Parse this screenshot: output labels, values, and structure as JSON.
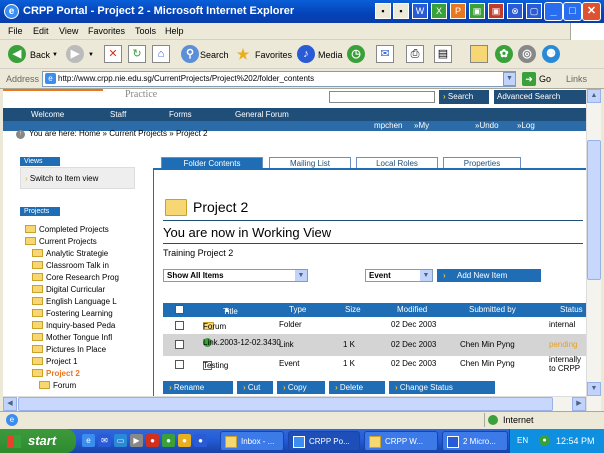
{
  "window": {
    "title": "CRPP Portal - Project 2 - Microsoft Internet Explorer"
  },
  "menu": [
    "File",
    "Edit",
    "View",
    "Favorites",
    "Tools",
    "Help"
  ],
  "toolbar": {
    "back": "Back",
    "search": "Search",
    "favorites": "Favorites",
    "media": "Media"
  },
  "address": {
    "label": "Address",
    "url": "http://www.crpp.nie.edu.sg/CurrentProjects/Project%202/folder_contents",
    "go": "Go",
    "links": "Links"
  },
  "site": {
    "practice": "Practice",
    "search_btn": "Search",
    "adv_search": "Advanced Search",
    "nav": [
      "Welcome",
      "Staff",
      "Forms",
      "General Forum"
    ],
    "user_links": [
      "mpchen",
      "My Profile",
      "Undo",
      "Log out"
    ]
  },
  "breadcrumb": {
    "prefix": "You are here:",
    "items": [
      "Home",
      "Current Projects",
      "Project 2"
    ]
  },
  "sidebar": {
    "views_header": "Views",
    "switch_link": "Switch to Item view",
    "projects_header": "Projects",
    "tree": [
      "Completed Projects",
      "Current Projects",
      "Analytic Strategie",
      "Classroom Talk in",
      "Core Research Prog",
      "Digital Curricular",
      "English Language L",
      "Fostering Learning",
      "Inquiry-based Peda",
      "Mother Tongue Infl",
      "Pictures In Place",
      "Project 1",
      "Project 2",
      "Forum"
    ]
  },
  "tabs": [
    "Folder Contents",
    "Mailing List",
    "Local Roles",
    "Properties"
  ],
  "main": {
    "title": "Project 2",
    "working": "You are now in Working View",
    "subtitle": "Training Project 2",
    "filter_value": "Show All Items",
    "type_value": "Event",
    "add_btn": "Add New Item"
  },
  "table": {
    "headers": [
      "Title",
      "Type",
      "Size",
      "Modified",
      "Submitted by",
      "Status"
    ],
    "rows": [
      {
        "title": "Forum",
        "type": "Folder",
        "size": "",
        "modified": "02 Dec 2003",
        "submitted": "",
        "status": "internal"
      },
      {
        "title": "Link.2003-12-02.3430",
        "type": "Link",
        "size": "1 K",
        "modified": "02 Dec 2003",
        "submitted": "Chen Min Pyng",
        "status": "pending"
      },
      {
        "title": "Testing",
        "type": "Event",
        "size": "1 K",
        "modified": "02 Dec 2003",
        "submitted": "Chen Min Pyng",
        "status": "internally to CRPP"
      }
    ]
  },
  "actions": [
    "Rename",
    "Cut",
    "Copy",
    "Delete",
    "Change Status"
  ],
  "status": {
    "zone": "Internet"
  },
  "taskbar": {
    "start": "start",
    "tasks": [
      "Inbox - ...",
      "CRPP Po...",
      "CRPP W...",
      "2 Micro..."
    ],
    "lang": "EN",
    "time": "12:54 PM"
  },
  "colors": {
    "nav_blue": "#1f4e79",
    "accent_blue": "#1f6db5",
    "pending": "#e8a020",
    "active_project": "#e87722"
  }
}
